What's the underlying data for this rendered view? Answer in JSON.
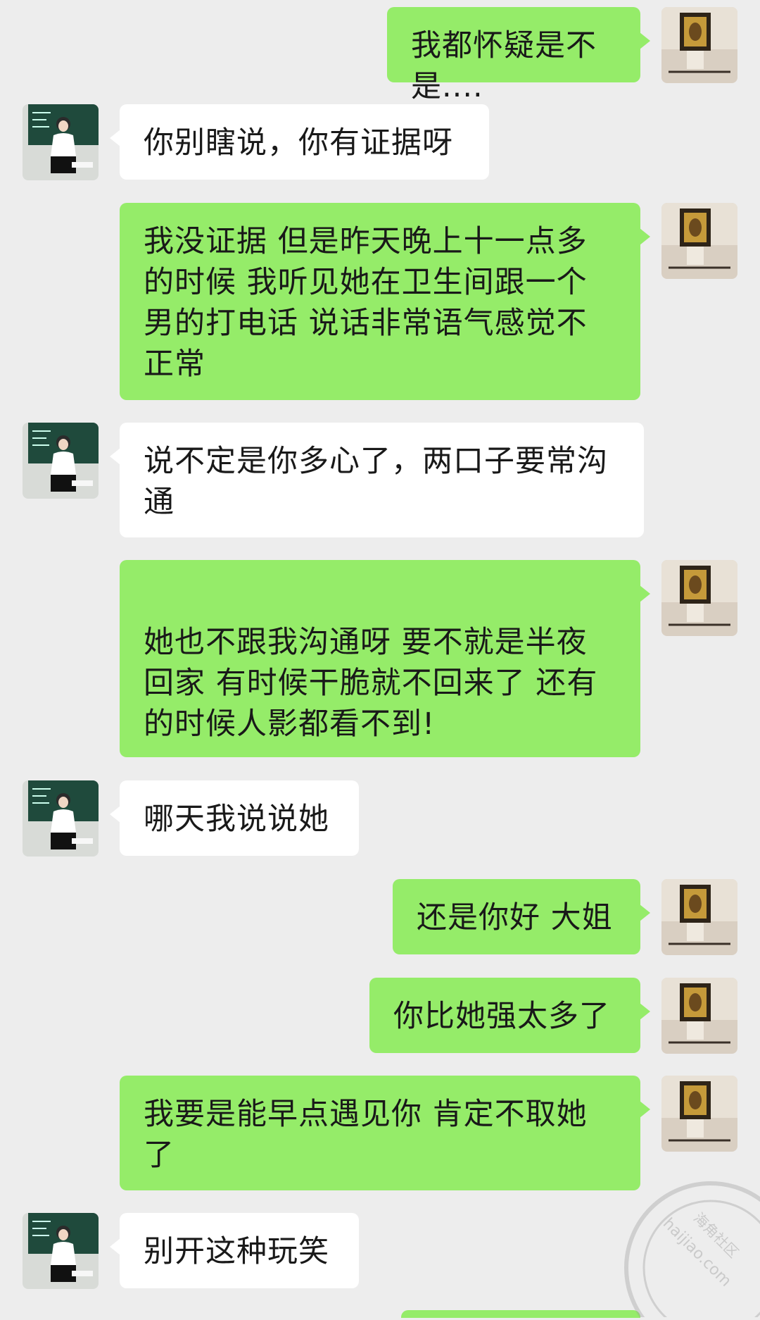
{
  "messages": [
    {
      "side": "mine",
      "text": "我都怀疑是不是...."
    },
    {
      "side": "theirs",
      "text": "你别瞎说，你有证据呀"
    },
    {
      "side": "mine",
      "text": "我没证据 但是昨天晚上十一点多的时候 我听见她在卫生间跟一个男的打电话 说话非常语气感觉不正常"
    },
    {
      "side": "theirs",
      "text": "说不定是你多心了，两口子要常沟通"
    },
    {
      "side": "mine",
      "text": "她也不跟我沟通呀 要不就是半夜回家 有时候干脆就不回来了 还有的时候人影都看不到!"
    },
    {
      "side": "theirs",
      "text": "哪天我说说她"
    },
    {
      "side": "mine",
      "text": "还是你好 大姐"
    },
    {
      "side": "mine",
      "text": "你比她强太多了"
    },
    {
      "side": "mine",
      "text": "我要是能早点遇见你 肯定不取她了"
    },
    {
      "side": "theirs",
      "text": "别开这种玩笑"
    }
  ],
  "watermark": {
    "site": "haijiao.com",
    "name": "海角社区"
  },
  "colors": {
    "background": "#ededed",
    "mine_bubble": "#95ec69",
    "theirs_bubble": "#ffffff"
  }
}
